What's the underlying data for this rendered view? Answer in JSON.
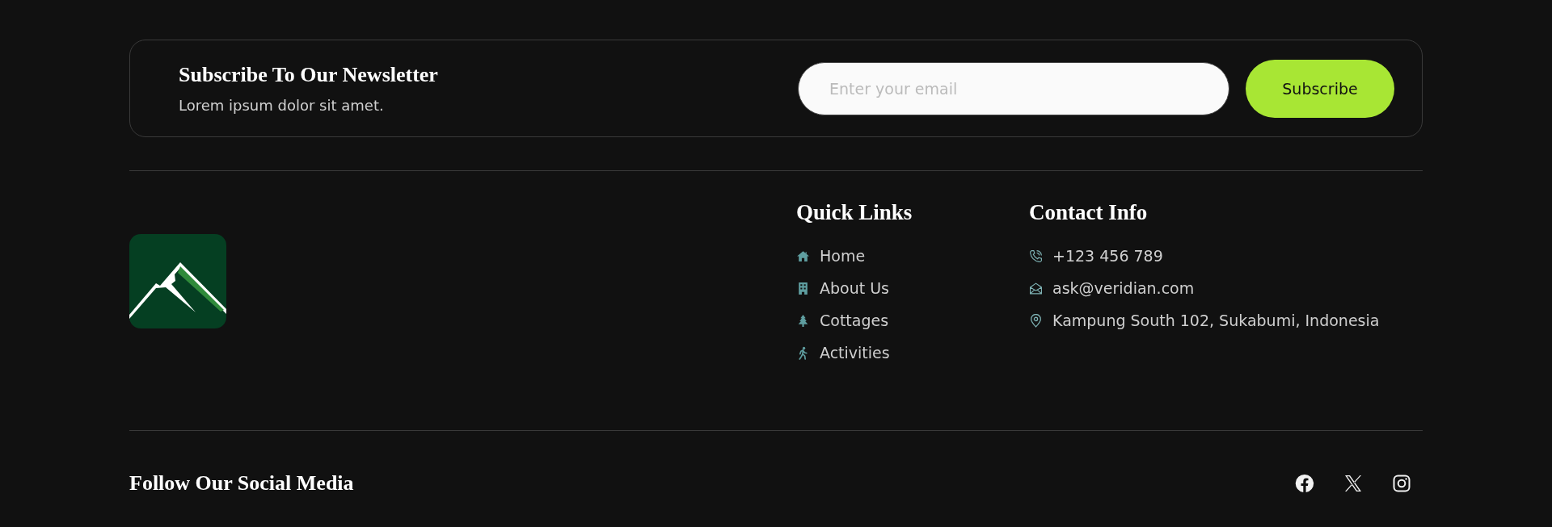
{
  "newsletter": {
    "title": "Subscribe To Our Newsletter",
    "text": "Lorem ipsum dolor sit amet.",
    "email_field": {
      "placeholder": "Enter your email"
    },
    "button": "Subscribe"
  },
  "quick_links": {
    "title": "Quick Links",
    "items": [
      "Home",
      "About Us",
      "Cottages",
      "Activities"
    ]
  },
  "contact_info": {
    "title": "Contact Info",
    "items": [
      "+123 456 789",
      "ask@veridian.com",
      "Kampung South 102, Sukabumi, Indonesia"
    ]
  },
  "social": {
    "title": "Follow Our Social Media"
  }
}
